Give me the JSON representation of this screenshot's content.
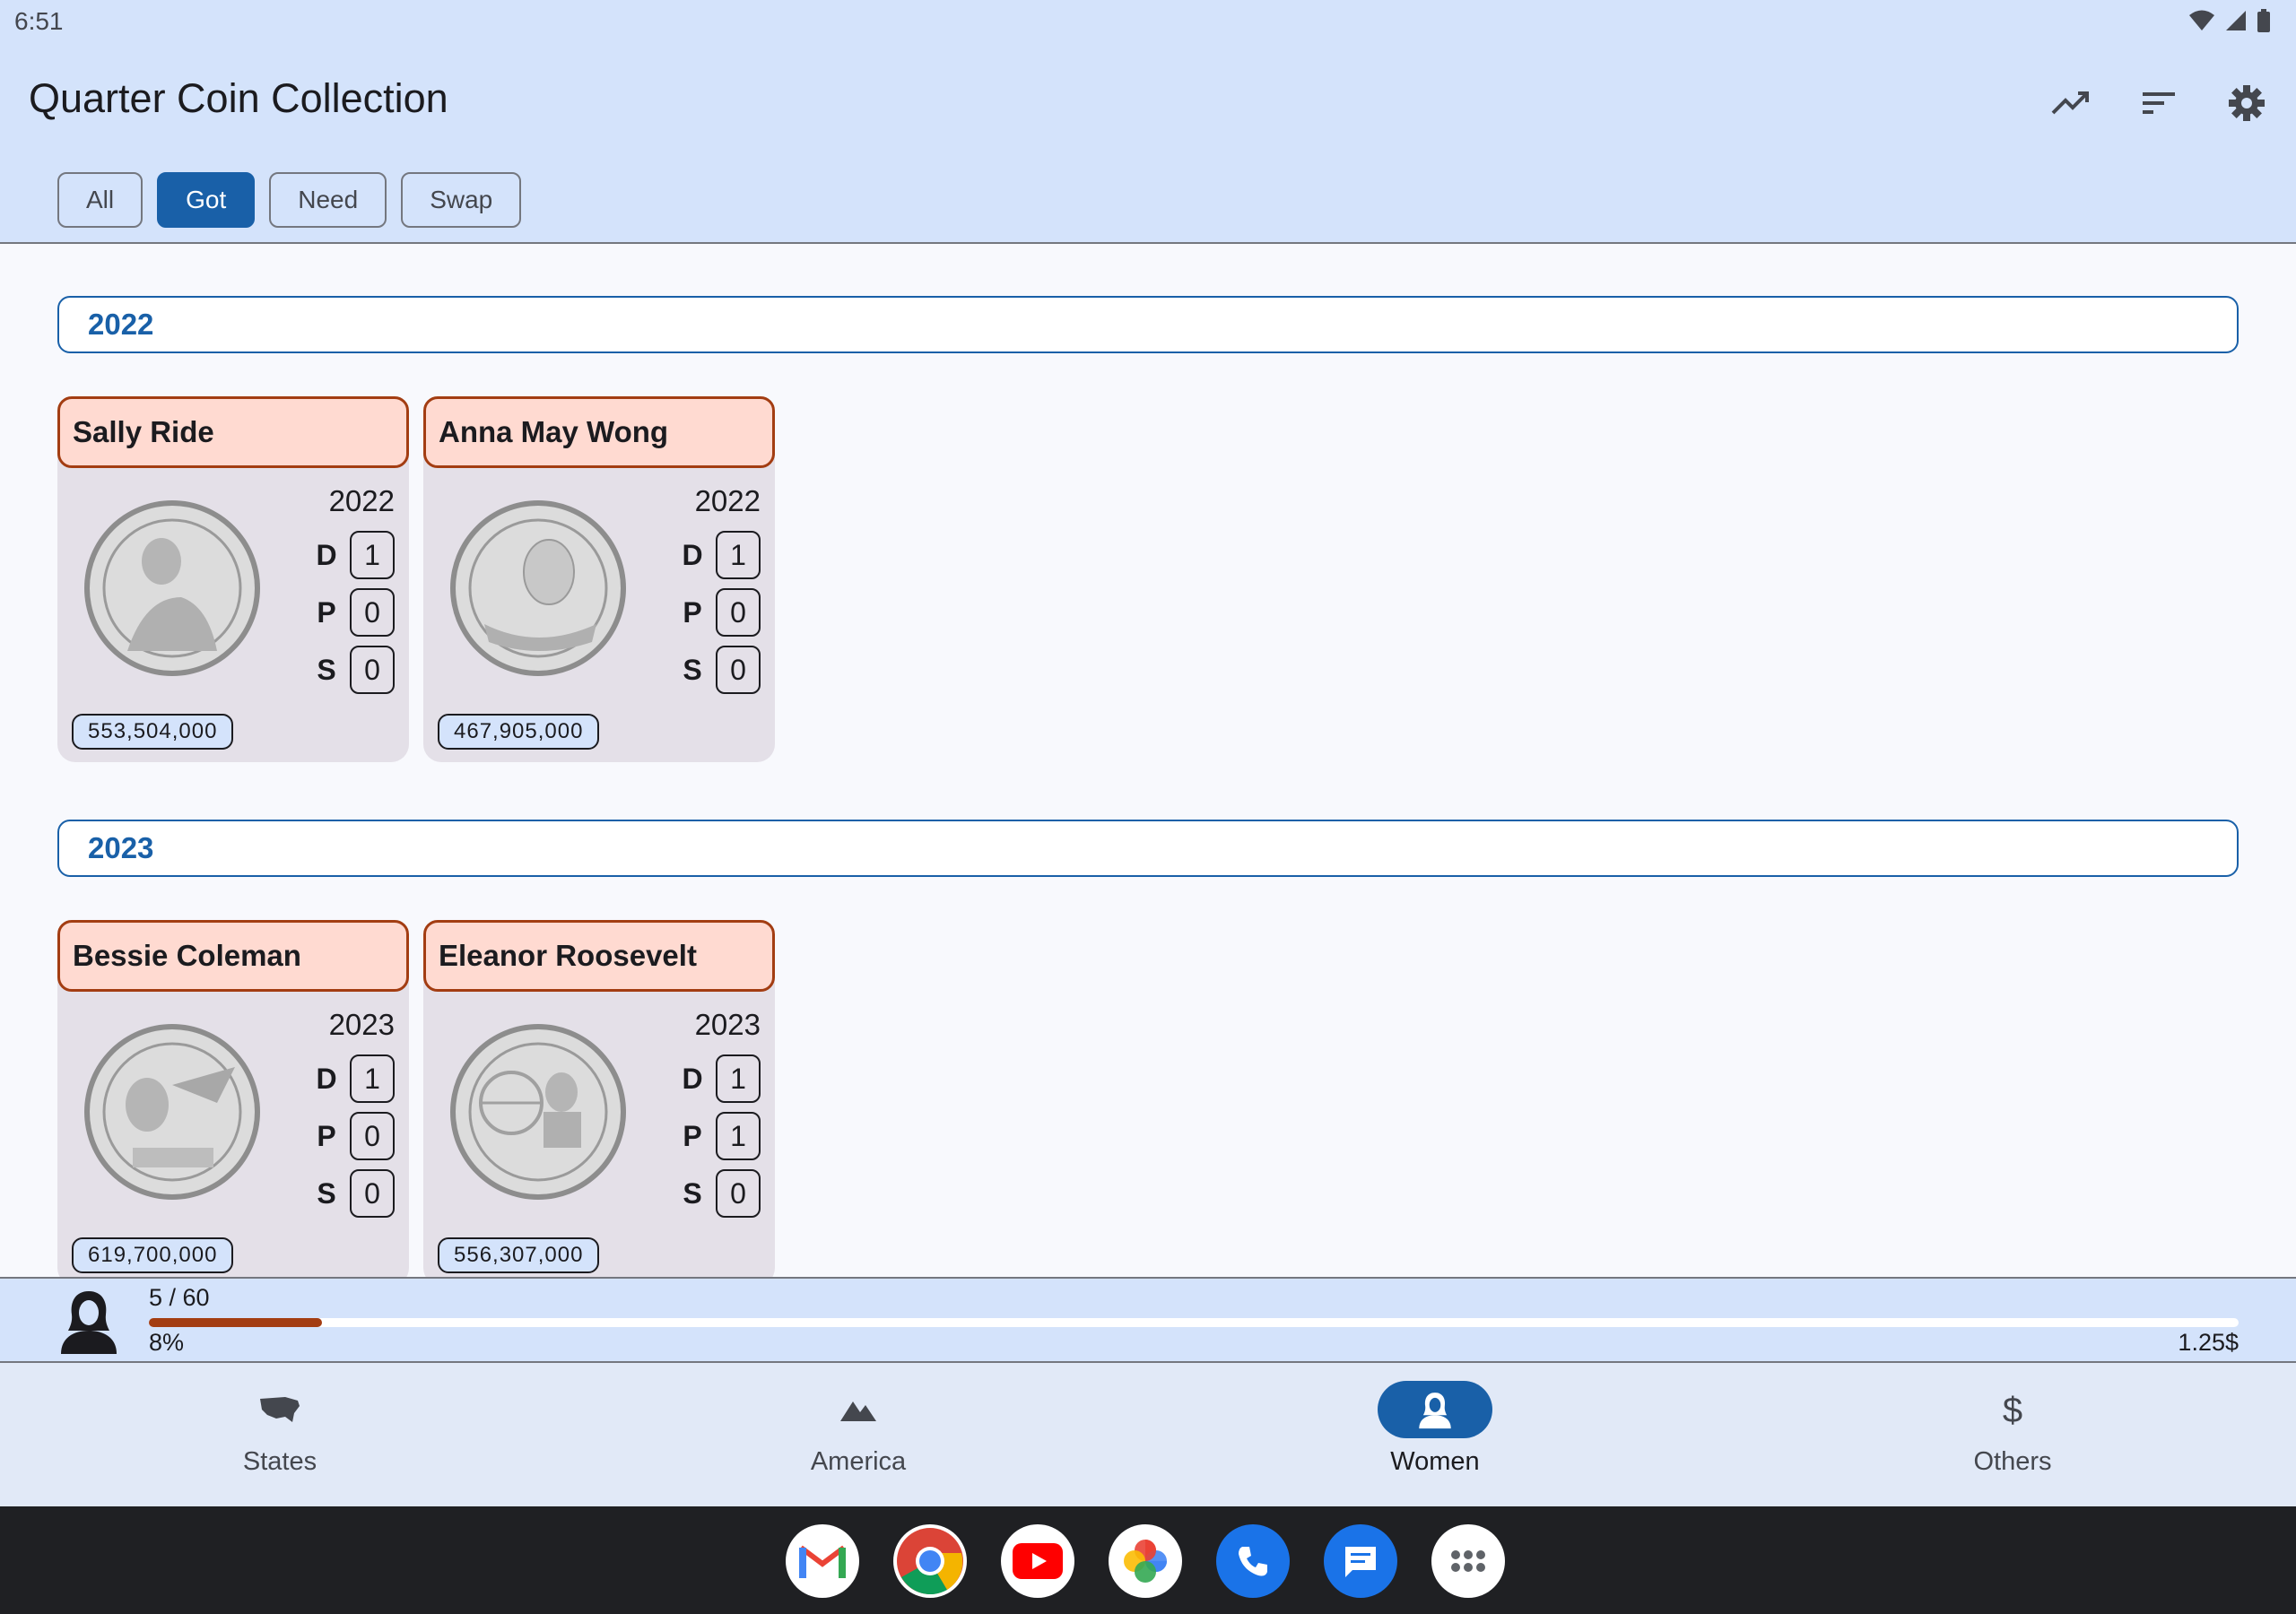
{
  "status_bar": {
    "time": "6:51"
  },
  "header": {
    "title": "Quarter Coin Collection"
  },
  "actions": [
    {
      "icon": "trending-up-icon"
    },
    {
      "icon": "sort-icon"
    },
    {
      "icon": "settings-gear-icon"
    }
  ],
  "filters": [
    {
      "label": "All",
      "selected": false
    },
    {
      "label": "Got",
      "selected": true
    },
    {
      "label": "Need",
      "selected": false
    },
    {
      "label": "Swap",
      "selected": false
    }
  ],
  "sections": [
    {
      "year": "2022",
      "coins": [
        {
          "name": "Sally Ride",
          "year": "2022",
          "mints": [
            {
              "label": "D",
              "count": "1"
            },
            {
              "label": "P",
              "count": "0"
            },
            {
              "label": "S",
              "count": "0"
            }
          ],
          "mintage": "553,504,000"
        },
        {
          "name": "Anna May Wong",
          "year": "2022",
          "mints": [
            {
              "label": "D",
              "count": "1"
            },
            {
              "label": "P",
              "count": "0"
            },
            {
              "label": "S",
              "count": "0"
            }
          ],
          "mintage": "467,905,000"
        }
      ]
    },
    {
      "year": "2023",
      "coins": [
        {
          "name": "Bessie Coleman",
          "year": "2023",
          "mints": [
            {
              "label": "D",
              "count": "1"
            },
            {
              "label": "P",
              "count": "0"
            },
            {
              "label": "S",
              "count": "0"
            }
          ],
          "mintage": "619,700,000"
        },
        {
          "name": "Eleanor Roosevelt",
          "year": "2023",
          "mints": [
            {
              "label": "D",
              "count": "1"
            },
            {
              "label": "P",
              "count": "1"
            },
            {
              "label": "S",
              "count": "0"
            }
          ],
          "mintage": "556,307,000"
        }
      ]
    }
  ],
  "progress": {
    "count": "5 / 60",
    "percent": "8%",
    "fraction": 0.083,
    "value": "1.25$"
  },
  "nav": [
    {
      "label": "States",
      "icon": "usa-map-icon",
      "active": false
    },
    {
      "label": "America",
      "icon": "mountains-icon",
      "active": false
    },
    {
      "label": "Women",
      "icon": "woman-icon",
      "active": true
    },
    {
      "label": "Others",
      "icon": "dollar-icon",
      "active": false
    }
  ],
  "dock": [
    {
      "icon": "gmail-icon"
    },
    {
      "icon": "chrome-icon"
    },
    {
      "icon": "youtube-icon"
    },
    {
      "icon": "photos-icon"
    },
    {
      "icon": "phone-icon"
    },
    {
      "icon": "messages-icon"
    },
    {
      "icon": "app-drawer-icon"
    }
  ],
  "colors": {
    "accent": "#1960a8",
    "card_header": "#ffdad1",
    "card_border": "#a33d12",
    "appbar": "#d4e3fb"
  }
}
